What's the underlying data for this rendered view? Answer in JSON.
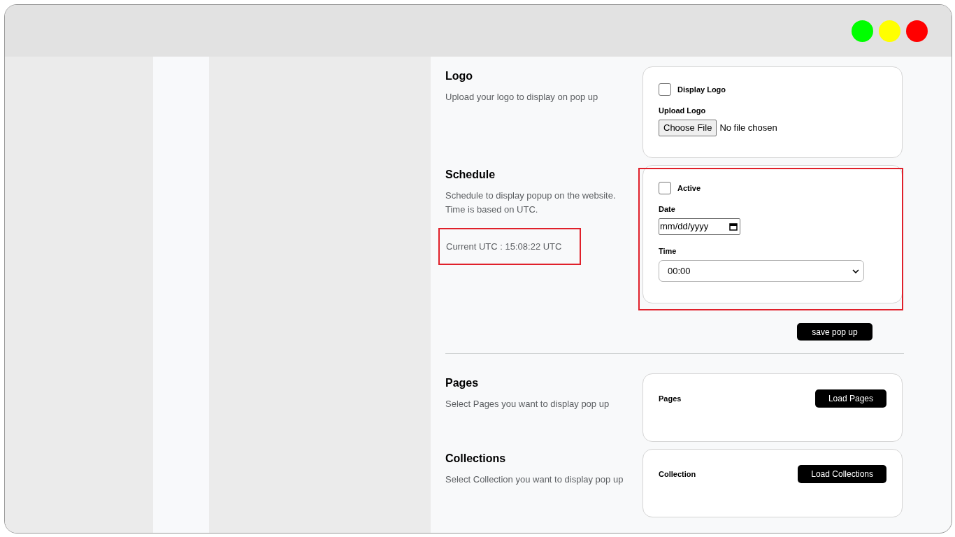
{
  "window_controls": [
    {
      "color": "#00ff00"
    },
    {
      "color": "#ffff00"
    },
    {
      "color": "#ff0000"
    }
  ],
  "sections": [
    {
      "title": "Logo",
      "description": [
        "Upload your logo to display on pop up"
      ],
      "card": {
        "highlighted": false,
        "fields": [
          {
            "kind": "checkbox",
            "label": "Display Logo",
            "checked": false
          },
          {
            "kind": "file",
            "label": "Upload Logo",
            "button": "Choose File",
            "status": "No file chosen"
          }
        ]
      }
    },
    {
      "title": "Schedule",
      "description": [
        "Schedule to display popup on the website.",
        "Time is based on UTC."
      ],
      "note": {
        "text": "Current UTC : 15:08:22 UTC",
        "highlighted": true
      },
      "card": {
        "highlighted": true,
        "fields": [
          {
            "kind": "checkbox",
            "label": "Active",
            "checked": false
          },
          {
            "kind": "date",
            "label": "Date",
            "placeholder": "mm/dd/yyyy"
          },
          {
            "kind": "select",
            "label": "Time",
            "value": "00:00"
          }
        ]
      },
      "action": "save pop up"
    },
    {
      "title": "Pages",
      "description": [
        "Select Pages you want to display pop up"
      ],
      "card": {
        "highlighted": false,
        "fields": [
          {
            "kind": "loader",
            "label": "Pages",
            "button": "Load Pages"
          }
        ]
      }
    },
    {
      "title": "Collections",
      "description": [
        "Select Collection you want to display pop up"
      ],
      "card": {
        "highlighted": false,
        "fields": [
          {
            "kind": "loader",
            "label": "Collection",
            "button": "Load Collections"
          }
        ]
      }
    }
  ]
}
